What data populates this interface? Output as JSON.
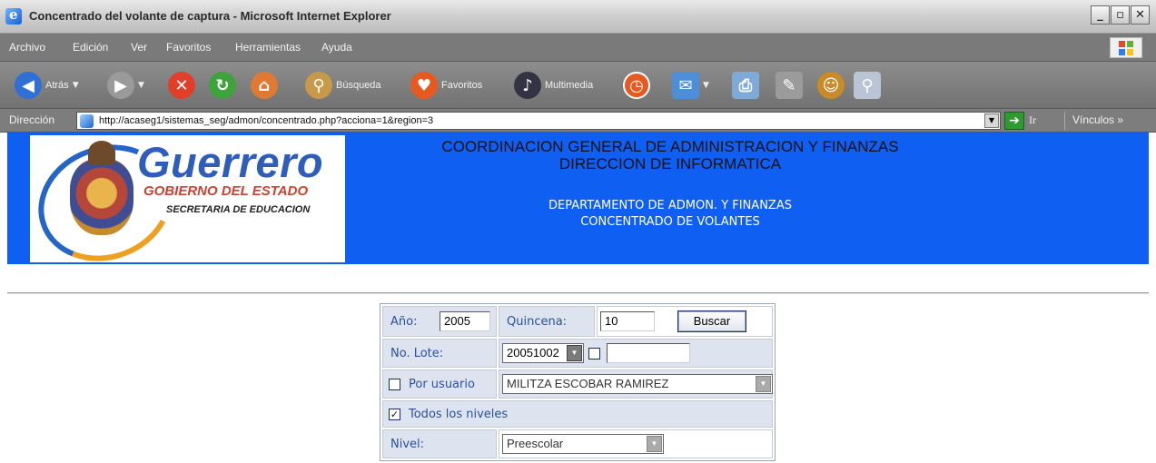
{
  "window": {
    "title": "Concentrado del volante de captura - Microsoft Internet Explorer",
    "buttons": {
      "minimize": "_",
      "maximize": "▫",
      "close": "✕"
    }
  },
  "menu": {
    "items": [
      "Archivo",
      "Edición",
      "Ver",
      "Favoritos",
      "Herramientas",
      "Ayuda"
    ]
  },
  "toolbar": {
    "back_label": "Atrás",
    "search_label": "Búsqueda",
    "favorites_label": "Favoritos",
    "media_label": "Multimedia"
  },
  "address": {
    "label": "Dirección",
    "url": "http://acaseg1/sistemas_seg/admon/concentrado.php?acciona=1&region=3",
    "go_label": "Ir",
    "links_label": "Vínculos »"
  },
  "header": {
    "logo_title": "Guerrero",
    "logo_subtitle": "GOBIERNO DEL ESTADO",
    "logo_secretaria": "SECRETARIA DE EDUCACION",
    "line1": "COORDINACION GENERAL DE ADMINISTRACION Y FINANZAS",
    "line2": "DIRECCION DE INFORMATICA",
    "line3": "DEPARTAMENTO DE ADMON. Y FINANZAS",
    "line4": "CONCENTRADO DE VOLANTES"
  },
  "form": {
    "anio_label": "Año:",
    "anio_value": "2005",
    "quincena_label": "Quincena:",
    "quincena_value": "10",
    "buscar_label": "Buscar",
    "lote_label": "No. Lote:",
    "lote_value": "20051002",
    "lote_checked": false,
    "lote_extra_value": "",
    "por_usuario_label": "Por usuario",
    "por_usuario_checked": false,
    "usuario_value": "MILITZA ESCOBAR RAMIREZ",
    "todos_niveles_label": "Todos los niveles",
    "todos_niveles_checked": true,
    "nivel_label": "Nivel:",
    "nivel_value": "Preescolar"
  },
  "colors": {
    "banner": "#0f5ff2",
    "label_text": "#2a4f9e",
    "label_cell": "#dde4ef"
  }
}
